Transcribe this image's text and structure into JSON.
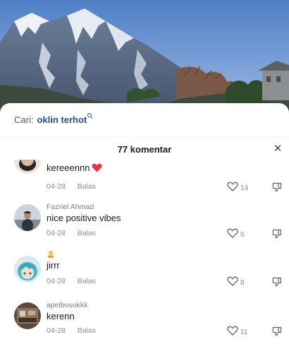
{
  "search": {
    "prefix": "Cari:",
    "query": "oklin terhot"
  },
  "comments_header": {
    "title": "77 komentar",
    "close_icon": "close-icon",
    "close_glyph": "×"
  },
  "comments": [
    {
      "username": "",
      "text": "kereeennn",
      "text_emoji": "red-heart",
      "date": "04-28",
      "reply_label": "Balas",
      "likes": "14"
    },
    {
      "username": "Fazriel Ahmad",
      "text": "nice positive vibes",
      "date": "04-28",
      "reply_label": "Balas",
      "likes": "6"
    },
    {
      "username": "",
      "username_emoji": "badge-emoji",
      "text": "jirrr",
      "date": "04-28",
      "reply_label": "Balas",
      "likes": "8"
    },
    {
      "username": "apelbosokkk",
      "text": "kerenn",
      "date": "04-28",
      "reply_label": "Balas",
      "likes": "11"
    }
  ],
  "colors": {
    "query_link": "#2a4e93",
    "secondary_text": "#8a8b91",
    "heart": "#e8343e"
  }
}
